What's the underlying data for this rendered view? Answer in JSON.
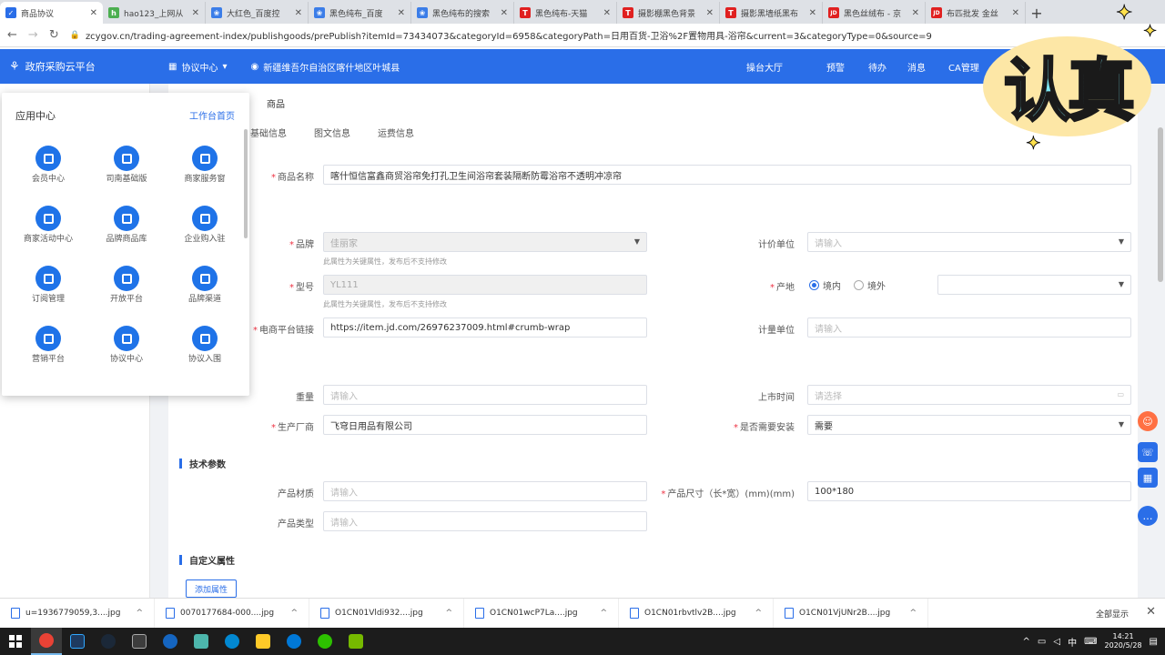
{
  "browser": {
    "tabs": [
      {
        "title": "商品协议",
        "color": "#2a6ee8",
        "glyph": "✓",
        "active": true
      },
      {
        "title": "hao123_上网从",
        "color": "#4caf50",
        "glyph": "h",
        "active": false
      },
      {
        "title": "大红色_百度控",
        "color": "#3b7de8",
        "glyph": "❀",
        "active": false
      },
      {
        "title": "黑色纯布_百度",
        "color": "#3b7de8",
        "glyph": "❀",
        "active": false
      },
      {
        "title": "黑色纯布的搜索",
        "color": "#3b7de8",
        "glyph": "❀",
        "active": false
      },
      {
        "title": "黑色纯布-天猫",
        "color": "#e02020",
        "glyph": "T",
        "active": false
      },
      {
        "title": "摄影棚黑色背景",
        "color": "#e02020",
        "glyph": "T",
        "active": false
      },
      {
        "title": "摄影黑墙纸黑布",
        "color": "#e02020",
        "glyph": "T",
        "active": false
      },
      {
        "title": "黑色丝绒布 - 京",
        "color": "#e02020",
        "glyph": "JD",
        "active": false
      },
      {
        "title": "布匹批发 金丝",
        "color": "#e02020",
        "glyph": "JD",
        "active": false
      }
    ],
    "new_tab": "+",
    "url": "zcygov.cn/trading-agreement-index/publishgoods/prePublish?itemId=73434073&categoryId=6958&categoryPath=日用百货-卫浴%2F置物用具-浴帘&current=3&categoryType=0&source=9"
  },
  "header": {
    "brand": "政府采购云平台",
    "menu": "协议中心",
    "location": "新疆维吾尔自治区喀什地区叶城县",
    "workbench": "操台大厅",
    "alert": "预警",
    "todo": "待办",
    "message": "消息",
    "ca": "CA管理"
  },
  "popup": {
    "title": "应用中心",
    "home_link": "工作台首页",
    "apps": [
      "会员中心",
      "司南基础版",
      "商家服务窗",
      "商家活动中心",
      "品牌商品库",
      "企业购入驻",
      "订阅管理",
      "开放平台",
      "品牌渠道",
      "营销平台",
      "协议中心",
      "协议入围"
    ]
  },
  "breadcrumb": "商品",
  "subtabs": [
    "基础信息",
    "图文信息",
    "运费信息"
  ],
  "form": {
    "product_name_label": "商品名称",
    "product_name_value": "喀什恒信富鑫商贸浴帘免打孔卫生间浴帘套装隔断防霉浴帘不透明冲凉帘",
    "brand_label": "品牌",
    "brand_value": "佳丽家",
    "brand_hint": "此属性为关键属性，发布后不支持修改",
    "price_unit_label": "计价单位",
    "price_unit_placeholder": "请输入",
    "model_label": "型号",
    "model_value": "YL111",
    "model_hint": "此属性为关键属性，发布后不支持修改",
    "origin_label": "产地",
    "origin_domestic": "境内",
    "origin_foreign": "境外",
    "ecommerce_label": "电商平台链接",
    "ecommerce_value": "https://item.jd.com/26976237009.html#crumb-wrap",
    "measure_unit_label": "计量单位",
    "measure_unit_placeholder": "请输入",
    "weight_label": "重量",
    "weight_placeholder": "请输入",
    "listing_time_label": "上市时间",
    "listing_time_placeholder": "请选择",
    "manufacturer_label": "生产厂商",
    "manufacturer_value": "飞穹日用品有限公司",
    "install_label": "是否需要安装",
    "install_value": "需要"
  },
  "tech": {
    "title": "技术参数",
    "material_label": "产品材质",
    "material_placeholder": "请输入",
    "size_label": "产品尺寸（长*宽）(mm)(mm)",
    "size_value": "100*180",
    "type_label": "产品类型",
    "type_placeholder": "请输入"
  },
  "custom": {
    "title": "自定义属性",
    "add_button": "添加属性"
  },
  "sticker": {
    "text": "认真"
  },
  "downloads": {
    "items": [
      "u=1936779059,3....jpg",
      "0070177684-000....jpg",
      "O1CN01Vldi932....jpg",
      "O1CN01wcP7La....jpg",
      "O1CN01rbvtlv2B....jpg",
      "O1CN01VjUNr2B....jpg"
    ],
    "show_all": "全部显示",
    "close": "✕"
  },
  "taskbar": {
    "ime": "中",
    "time": "14:21",
    "date": "2020/5/28"
  }
}
